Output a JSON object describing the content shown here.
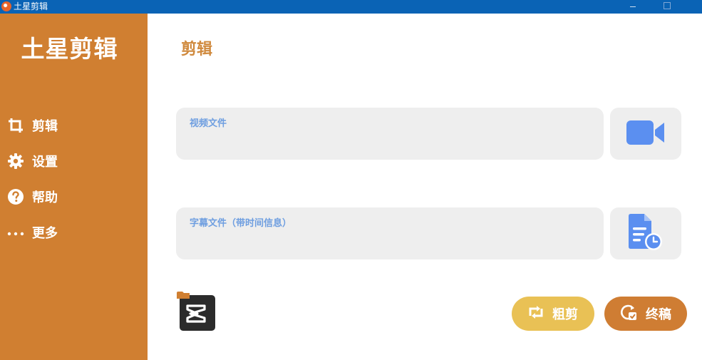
{
  "window": {
    "title": "土星剪辑",
    "titlebar_color": "#0a63b5"
  },
  "sidebar": {
    "brand": "土星剪辑",
    "background": "#d07f31",
    "items": [
      {
        "label": "剪辑",
        "icon": "crop-icon"
      },
      {
        "label": "设置",
        "icon": "gear-icon"
      },
      {
        "label": "帮助",
        "icon": "help-icon"
      },
      {
        "label": "更多",
        "icon": "more-icon"
      }
    ]
  },
  "main": {
    "title": "剪辑",
    "video_field": {
      "label": "视频文件",
      "value": "",
      "icon": "video-camera-icon"
    },
    "subtitle_field": {
      "label": "字幕文件（带时间信息）",
      "value": "",
      "icon": "document-clock-icon"
    },
    "capcut_icon": "capcut-app-icon",
    "buttons": {
      "rough_cut": {
        "label": "粗剪",
        "icon": "repeat-icon",
        "color": "#e9c155"
      },
      "final_cut": {
        "label": "终稿",
        "icon": "refresh-check-icon",
        "color": "#cf7d33"
      }
    }
  }
}
